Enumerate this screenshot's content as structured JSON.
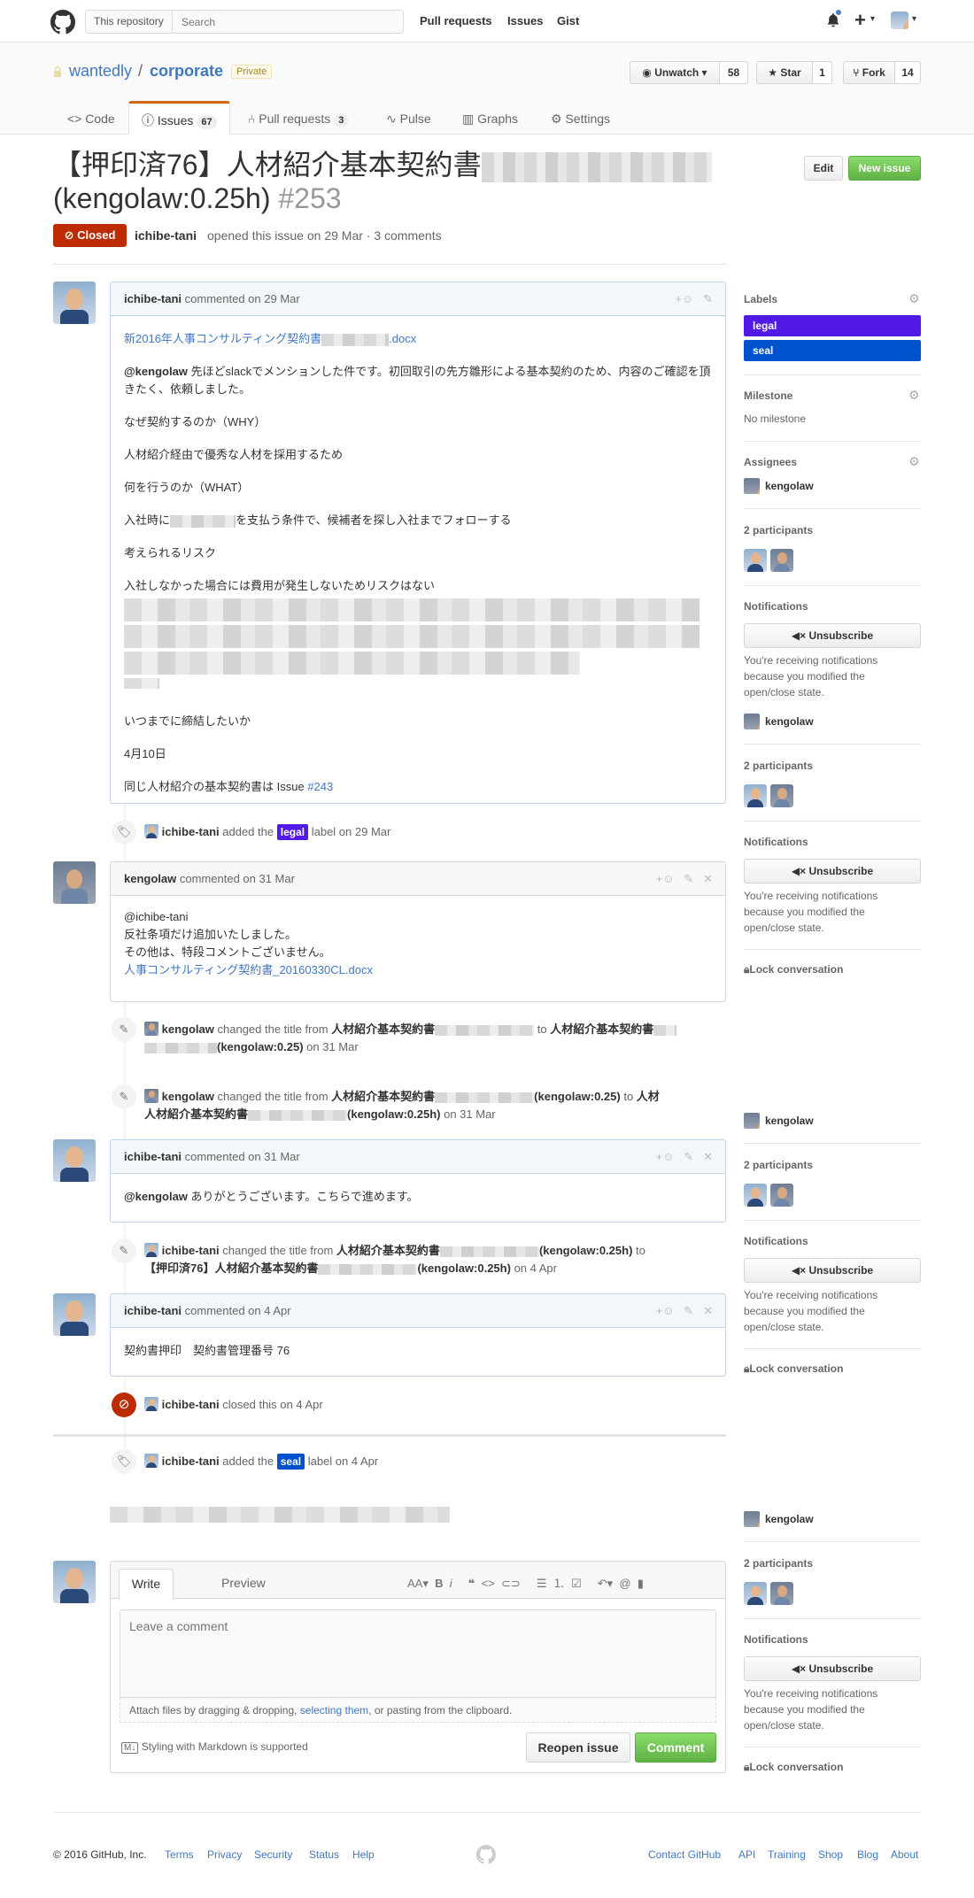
{
  "header": {
    "search_scope": "This repository",
    "search_placeholder": "Search",
    "nav": [
      "Pull requests",
      "Issues",
      "Gist"
    ],
    "plus": "+",
    "caret": "▾"
  },
  "repo": {
    "owner": "wantedly",
    "sep": "/",
    "name": "corporate",
    "visibility": "Private",
    "unwatch_label": "Unwatch ▾",
    "watch_count": "58",
    "star_label": "Star",
    "star_count": "1",
    "fork_label": "Fork",
    "fork_count": "14",
    "tabs": {
      "code": "Code",
      "issues": "Issues",
      "issues_count": "67",
      "pulls": "Pull requests",
      "pulls_count": "3",
      "pulse": "Pulse",
      "graphs": "Graphs",
      "settings": "Settings"
    }
  },
  "issue": {
    "title_part1": "【押印済76】人材紹介基本契約書",
    "title_part2": "(kengolaw:0.25h)",
    "number": "#253",
    "edit_label": "Edit",
    "new_issue_label": "New issue",
    "state": "Closed",
    "author": "ichibe-tani",
    "meta": "opened this issue on 29 Mar · 3 comments"
  },
  "comments": {
    "c1": {
      "author": "ichibe-tani",
      "when": "commented on 29 Mar",
      "file_prefix": "新2016年人事コンサルティング契約書",
      "file_suffix": ".docx",
      "mention": "@kengolaw",
      "p1_rest": " 先ほどslackでメンションした件です。初回取引の先方雛形による基本契約のため、内容のご確認を頂きたく、依頼しました。",
      "why_h": "なぜ契約するのか（WHY）",
      "why": "人材紹介経由で優秀な人材を採用するため",
      "what_h": "何を行うのか（WHAT）",
      "what_pre": "入社時に",
      "what_post": "を支払う条件で、候補者を探し入社までフォローする",
      "risk_h": "考えられるリスク",
      "risk": "入社しなかった場合には費用が発生しないためリスクはない",
      "when_h": "いつまでに締結したいか",
      "date": "4月10日",
      "ref_pre": "同じ人材紹介の基本契約書は Issue ",
      "ref_link": "#243"
    },
    "e1": {
      "actor": "ichibe-tani",
      "text1": "added the",
      "label": "legal",
      "text2": "label on 29 Mar"
    },
    "c2": {
      "author": "kengolaw",
      "when": "commented on 31 Mar",
      "line1": "@ichibe-tani",
      "line2": "反社条項だけ追加いたしました。",
      "line3": "その他は、特段コメントございません。",
      "file": "人事コンサルティング契約書_20160330CL.docx"
    },
    "e2": {
      "actor": "kengolaw",
      "text": "changed the title from",
      "from": "人材紹介基本契約書",
      "to_word": "to",
      "to": "人材紹介基本契約書",
      "to_suffix": "(kengolaw:0.25)",
      "date": "on 31 Mar"
    },
    "e3": {
      "actor": "kengolaw",
      "text": "changed the title from",
      "from": "人材紹介基本契約書",
      "from_suffix": "(kengolaw:0.25)",
      "to_word": "to",
      "to": "人材紹介基本契約書",
      "to_suffix": "(kengolaw:0.25h)",
      "date": "on 31 Mar"
    },
    "c3": {
      "author": "ichibe-tani",
      "when": "commented on 31 Mar",
      "mention": "@kengolaw",
      "text": " ありがとうございます。こちらで進めます。"
    },
    "e4": {
      "actor": "ichibe-tani",
      "text": "changed the title from",
      "from": "人材紹介基本契約書",
      "from_suffix": "(kengolaw:0.25h)",
      "to_word": "to",
      "to": "【押印済76】人材紹介基本契約書",
      "to_suffix": "(kengolaw:0.25h)",
      "date": "on 4 Apr"
    },
    "c4": {
      "author": "ichibe-tani",
      "when": "commented on 4 Apr",
      "text": "契約書押印　契約書管理番号 76"
    },
    "e5": {
      "actor": "ichibe-tani",
      "text": "closed this on 4 Apr"
    },
    "e6": {
      "actor": "ichibe-tani",
      "text1": "added the",
      "label": "seal",
      "text2": "label on 4 Apr"
    }
  },
  "editor": {
    "tab_write": "Write",
    "tab_preview": "Preview",
    "placeholder": "Leave a comment",
    "attach_pre": "Attach files by dragging & dropping, ",
    "attach_link": "selecting them",
    "attach_post": ", or pasting from the clipboard.",
    "markdown_note": "Styling with Markdown is supported",
    "reopen_label": "Reopen issue",
    "comment_label": "Comment"
  },
  "sidebar": {
    "labels_h": "Labels",
    "label1": "legal",
    "label2": "seal",
    "milestone_h": "Milestone",
    "milestone_val": "No milestone",
    "assignees_h": "Assignees",
    "assignee": "kengolaw",
    "participants_h": "2 participants",
    "notifications_h": "Notifications",
    "unsubscribe_label": "Unsubscribe",
    "notif_text_1": "You're receiving notifications",
    "notif_text_2": "because you modified the",
    "notif_text_3": "open/close state.",
    "lock_label": "Lock conversation"
  },
  "footer": {
    "copyright": "© 2016 GitHub, Inc.",
    "left_links": [
      "Terms",
      "Privacy",
      "Security",
      "Status",
      "Help"
    ],
    "right_links": [
      "Contact GitHub",
      "API",
      "Training",
      "Shop",
      "Blog",
      "About"
    ]
  },
  "colors": {
    "label_legal": "#5319e7",
    "label_seal": "#0052cc",
    "closed": "#bd2c00",
    "new_issue": "#6cc644",
    "accent_tab": "#d26911"
  }
}
